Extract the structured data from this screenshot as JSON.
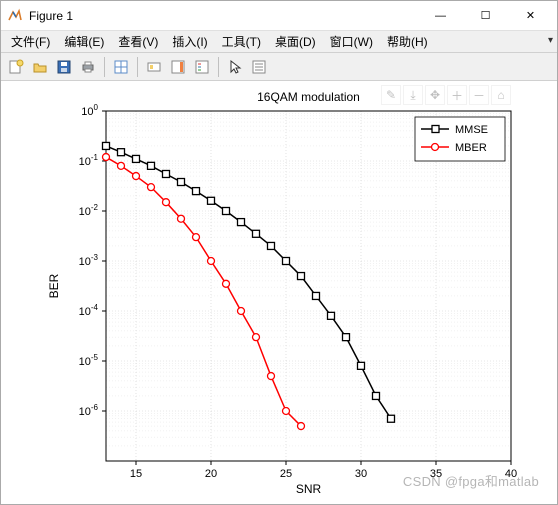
{
  "window": {
    "title": "Figure 1",
    "minimize": "—",
    "maximize": "☐",
    "close": "✕"
  },
  "menu": {
    "file": "文件(F)",
    "edit": "编辑(E)",
    "view": "查看(V)",
    "insert": "插入(I)",
    "tools": "工具(T)",
    "desktop": "桌面(D)",
    "window": "窗口(W)",
    "help": "帮助(H)"
  },
  "toolbar_icons": {
    "new": "new-figure-icon",
    "open": "open-icon",
    "save": "save-icon",
    "print": "print-icon",
    "datacursor": "data-cursor-icon",
    "link": "link-icon",
    "colorbar": "insert-colorbar-icon",
    "legend": "insert-legend-icon",
    "arrow": "pointer-icon",
    "propedit": "property-editor-icon"
  },
  "axes_tools": {
    "brush": "brush-icon",
    "export": "export-icon",
    "pan": "pan-icon",
    "zoomin": "zoom-in-icon",
    "zoomout": "zoom-out-icon",
    "home": "home-icon"
  },
  "watermark": "CSDN @fpga和matlab",
  "chart_data": {
    "type": "line",
    "title": "16QAM modulation",
    "xlabel": "SNR",
    "ylabel": "BER",
    "xlim": [
      13,
      40
    ],
    "ylim": [
      1e-07,
      1
    ],
    "xticks": [
      15,
      20,
      25,
      30,
      35,
      40
    ],
    "ylog_exponents": [
      0,
      -1,
      -2,
      -3,
      -4,
      -5,
      -6
    ],
    "legend_position": "upper-right",
    "series": [
      {
        "name": "MMSE",
        "color": "#000000",
        "marker": "square",
        "x": [
          13,
          14,
          15,
          16,
          17,
          18,
          19,
          20,
          21,
          22,
          23,
          24,
          25,
          26,
          27,
          28,
          29,
          30,
          31,
          32
        ],
        "y": [
          0.2,
          0.15,
          0.11,
          0.08,
          0.055,
          0.038,
          0.025,
          0.016,
          0.01,
          0.006,
          0.0035,
          0.002,
          0.001,
          0.0005,
          0.0002,
          8e-05,
          3e-05,
          8e-06,
          2e-06,
          7e-07
        ]
      },
      {
        "name": "MBER",
        "color": "#ff0000",
        "marker": "circle",
        "x": [
          13,
          14,
          15,
          16,
          17,
          18,
          19,
          20,
          21,
          22,
          23,
          24,
          25,
          26
        ],
        "y": [
          0.12,
          0.08,
          0.05,
          0.03,
          0.015,
          0.007,
          0.003,
          0.001,
          0.00035,
          0.0001,
          3e-05,
          5e-06,
          1e-06,
          5e-07
        ]
      }
    ]
  }
}
